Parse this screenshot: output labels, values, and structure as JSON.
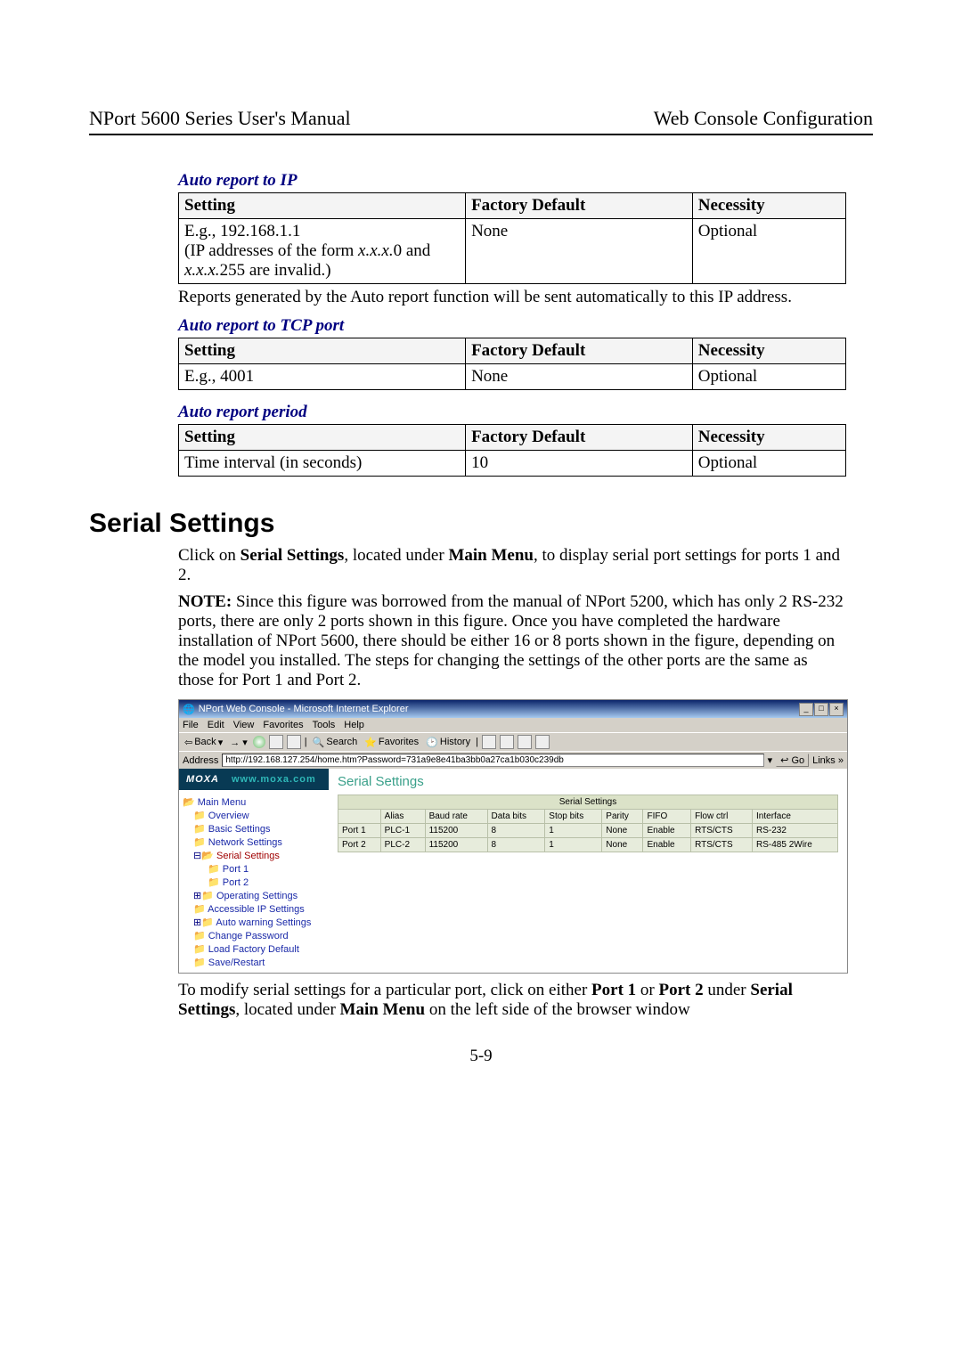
{
  "header": {
    "left": "NPort 5600 Series User's Manual",
    "right": "Web Console Configuration"
  },
  "section1": {
    "title": "Auto report to IP",
    "headers": {
      "c1": "Setting",
      "c2": "Factory Default",
      "c3": "Necessity"
    },
    "row1": {
      "c1a": "E.g., 192.168.1.1",
      "c1b_pre": "(IP addresses of the form ",
      "c1b_it1": "x.x.x.",
      "c1b_mid": "0 and ",
      "c1b_it2": "x.x.x.",
      "c1b_post": "255 are invalid.)",
      "c2": "None",
      "c3": "Optional"
    },
    "note": "Reports generated by the Auto report function will be sent automatically to this IP address."
  },
  "section2": {
    "title": "Auto report to TCP port",
    "headers": {
      "c1": "Setting",
      "c2": "Factory Default",
      "c3": "Necessity"
    },
    "row1": {
      "c1": "E.g., 4001",
      "c2": "None",
      "c3": "Optional"
    }
  },
  "section3": {
    "title": "Auto report period",
    "headers": {
      "c1": "Setting",
      "c2": "Factory Default",
      "c3": "Necessity"
    },
    "row1": {
      "c1": "Time interval (in seconds)",
      "c2": "10",
      "c3": "Optional"
    }
  },
  "serial": {
    "heading": "Serial Settings",
    "p1_a": "Click on ",
    "p1_b": "Serial Settings",
    "p1_c": ", located under ",
    "p1_d": "Main Menu",
    "p1_e": ", to display serial port settings for ports 1 and 2.",
    "p2_a": "NOTE:",
    "p2_b": " Since this figure was borrowed from the manual of NPort 5200, which has only 2 RS-232 ports, there are only 2 ports shown in this figure. Once you have completed the hardware installation of NPort 5600, there should be either 16 or 8 ports shown in the figure, depending on the model you installed. The steps for changing the settings of the other ports are the same as those for Port 1 and Port 2.",
    "p3_a": "To modify serial settings for a particular port, click on either ",
    "p3_b": "Port 1",
    "p3_c": " or ",
    "p3_d": "Port 2",
    "p3_e": " under ",
    "p3_f": "Serial Settings",
    "p3_g": ", located under ",
    "p3_h": "Main Menu",
    "p3_i": " on the left side of the browser window"
  },
  "screenshot": {
    "title": "NPort Web Console - Microsoft Internet Explorer",
    "win": {
      "min": "_",
      "max": "□",
      "close": "×"
    },
    "menu": [
      "File",
      "Edit",
      "View",
      "Favorites",
      "Tools",
      "Help"
    ],
    "toolbar": {
      "back": "Back",
      "search": "Search",
      "favorites": "Favorites",
      "history": "History"
    },
    "address_label": "Address",
    "address_value": "http://192.168.127.254/home.htm?Password=731a9e8e41ba3bb0a27ca1b030c239db",
    "go": "Go",
    "links": "Links",
    "moxa_logo": "MOXA",
    "moxa_url": "www.moxa.com",
    "tree": {
      "main": "Main Menu",
      "overview": "Overview",
      "basic": "Basic Settings",
      "network": "Network Settings",
      "serial": "Serial Settings",
      "port1": "Port 1",
      "port2": "Port 2",
      "operating": "Operating Settings",
      "accessible": "Accessible IP Settings",
      "autowarn": "Auto warning Settings",
      "changepw": "Change Password",
      "loadfactory": "Load Factory Default",
      "saverestart": "Save/Restart"
    },
    "main_heading": "Serial Settings",
    "table_caption": "Serial Settings",
    "cols": {
      "port": "",
      "alias": "Alias",
      "baud": "Baud rate",
      "databits": "Data bits",
      "stopbits": "Stop bits",
      "parity": "Parity",
      "fifo": "FIFO",
      "flow": "Flow ctrl",
      "iface": "Interface"
    },
    "rows": [
      {
        "port": "Port 1",
        "alias": "PLC-1",
        "baud": "115200",
        "databits": "8",
        "stopbits": "1",
        "parity": "None",
        "fifo": "Enable",
        "flow": "RTS/CTS",
        "iface": "RS-232"
      },
      {
        "port": "Port 2",
        "alias": "PLC-2",
        "baud": "115200",
        "databits": "8",
        "stopbits": "1",
        "parity": "None",
        "fifo": "Enable",
        "flow": "RTS/CTS",
        "iface": "RS-485 2Wire"
      }
    ]
  },
  "pagenum": "5-9"
}
